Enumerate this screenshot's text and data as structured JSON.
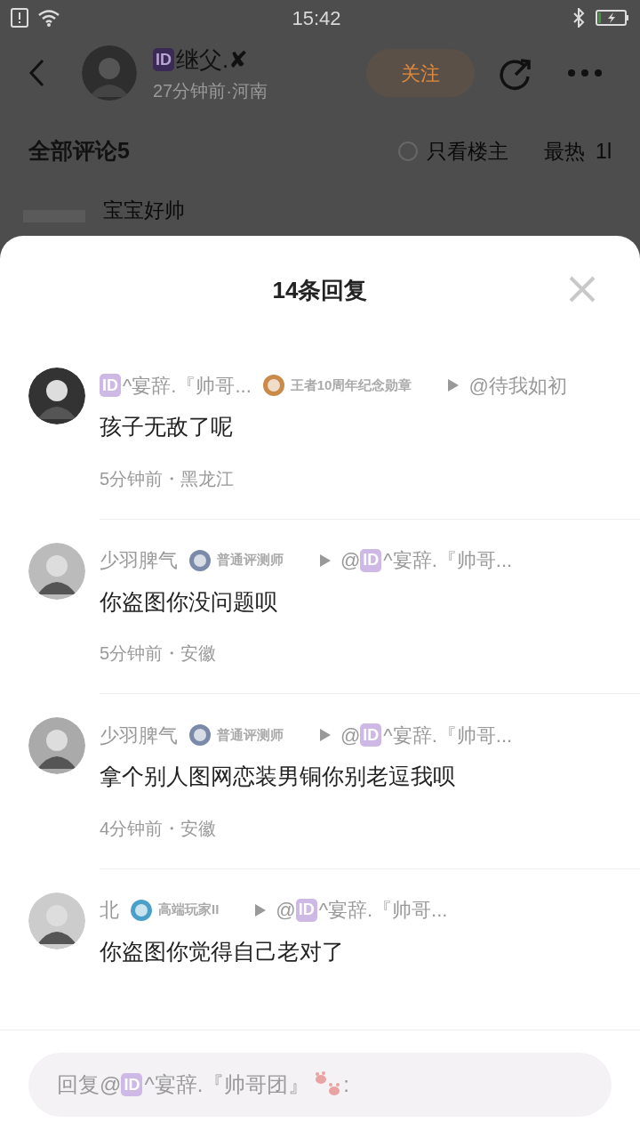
{
  "status_bar": {
    "time": "15:42"
  },
  "post_header": {
    "author_badge": "ID",
    "author": "继父.✘",
    "meta": "27分钟前·河南",
    "follow": "关注"
  },
  "comments_header": {
    "title": "全部评论5",
    "only_op": {
      "label": "只看楼主",
      "checked": false
    },
    "sort": "最热",
    "sort_cut": "1l"
  },
  "peek_comment": "宝宝好帅",
  "sheet": {
    "title": "14条回复",
    "replies": [
      {
        "name_badge": "ID",
        "name": "^宴辞.『帅哥...",
        "medal": "王者10周年纪念勋章",
        "target": "@待我如初",
        "text": "孩子无敌了呢",
        "meta": "5分钟前・黑龙江"
      },
      {
        "name": "少羽脾气",
        "medal": "普通评测师",
        "target_at": "@",
        "target_badge": "ID",
        "target": "^宴辞.『帅哥...",
        "text": "你盗图你没问题呗",
        "meta": "5分钟前・安徽"
      },
      {
        "name": "少羽脾气",
        "medal": "普通评测师",
        "target_at": "@",
        "target_badge": "ID",
        "target": "^宴辞.『帅哥...",
        "text": "拿个别人图网恋装男铜你别老逗我呗",
        "meta": "4分钟前・安徽"
      },
      {
        "name": "北",
        "medal": "高端玩家II",
        "target_at": "@",
        "target_badge": "ID",
        "target": "^宴辞.『帅哥...",
        "text": "你盗图你觉得自己老对了"
      }
    ],
    "input": {
      "prefix": "回复@",
      "badge": "ID",
      "name": "^宴辞.『帅哥团』",
      "suffix": ":"
    }
  }
}
